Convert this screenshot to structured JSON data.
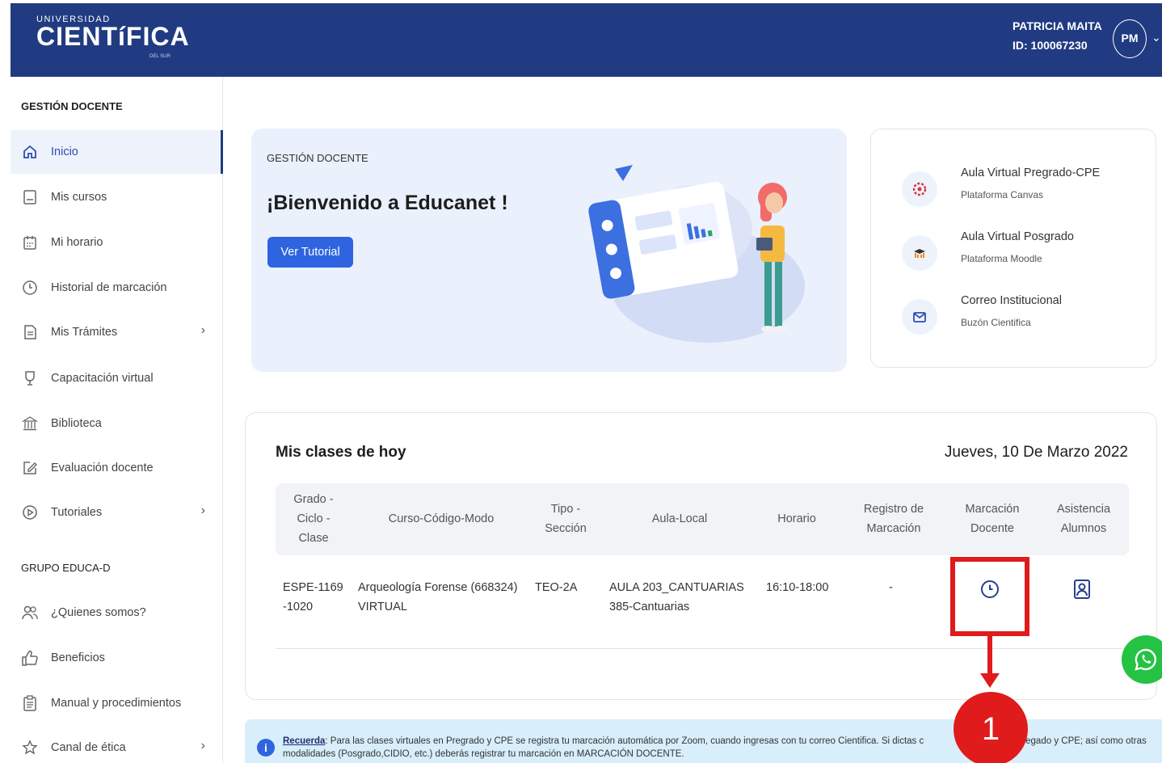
{
  "header": {
    "logo_top": "UNIVERSIDAD",
    "logo_main": "CIENTíFICA",
    "logo_sub": "DEL SUR",
    "user_name": "PATRICIA MAITA",
    "user_id": "ID: 100067230",
    "avatar_initials": "PM"
  },
  "sidebar": {
    "section1": "GESTIÓN DOCENTE",
    "items": [
      {
        "label": "Inicio"
      },
      {
        "label": "Mis cursos"
      },
      {
        "label": "Mi horario"
      },
      {
        "label": "Historial de marcación"
      },
      {
        "label": "Mis Trámites"
      },
      {
        "label": "Capacitación virtual"
      },
      {
        "label": "Biblioteca"
      },
      {
        "label": "Evaluación docente"
      },
      {
        "label": "Tutoriales"
      }
    ],
    "section2": "GRUPO EDUCA-D",
    "items2": [
      {
        "label": "¿Quienes somos?"
      },
      {
        "label": "Beneficios"
      },
      {
        "label": "Manual y procedimientos"
      },
      {
        "label": "Canal de ética"
      }
    ]
  },
  "welcome": {
    "eyebrow": "GESTIÓN DOCENTE",
    "title": "¡Bienvenido a Educanet !",
    "button": "Ver Tutorial"
  },
  "links": [
    {
      "title": "Aula Virtual Pregrado-CPE",
      "subtitle": "Plataforma Canvas"
    },
    {
      "title": "Aula Virtual Posgrado",
      "subtitle": "Plataforma Moodle"
    },
    {
      "title": "Correo Institucional",
      "subtitle": "Buzón Cientifica"
    }
  ],
  "classes": {
    "title": "Mis clases de hoy",
    "date": "Jueves, 10 De Marzo 2022",
    "headers": {
      "grado_1": "Grado -",
      "grado_2": "Ciclo -",
      "grado_3": "Clase",
      "curso": "Curso-Código-Modo",
      "tipo_1": "Tipo -",
      "tipo_2": "Sección",
      "aula": "Aula-Local",
      "horario": "Horario",
      "registro_1": "Registro de",
      "registro_2": "Marcación",
      "marcacion_1": "Marcación",
      "marcacion_2": "Docente",
      "asistencia_1": "Asistencia",
      "asistencia_2": "Alumnos"
    },
    "row": {
      "grado_1": "ESPE-1169",
      "grado_2": "-1020",
      "curso_1": "Arqueología Forense (668324)",
      "curso_2": "VIRTUAL",
      "tipo": "TEO-2A",
      "aula_1": "AULA 203_CANTUARIAS",
      "aula_2": "385-Cantuarias",
      "horario": "16:10-18:00",
      "registro": "-"
    }
  },
  "annotation": {
    "number": "1",
    "color": "#e01b1b"
  },
  "notice": {
    "strong": "Recuerda",
    "text_1": ": Para las clases virtuales en Pregrado y CPE se registra tu marcación automática por Zoom, cuando ingresas con tu correo Cientifica. Si dictas c",
    "text_2": "es en Pregado y CPE; así como otras modalidades (Posgrado,CIDIO, etc.) deberás registrar tu marcación en MARCACIÓN DOCENTE."
  },
  "colors": {
    "header": "#213b82",
    "primary_button": "#2e64e0",
    "whatsapp": "#25c244"
  },
  "icons": {
    "sidebar": [
      "home-icon",
      "book-icon",
      "calendar-icon",
      "clock-icon",
      "document-icon",
      "trophy-icon",
      "library-icon",
      "edit-icon",
      "play-icon"
    ],
    "sidebar2": [
      "users-icon",
      "thumbs-up-icon",
      "clipboard-icon",
      "star-icon"
    ]
  }
}
